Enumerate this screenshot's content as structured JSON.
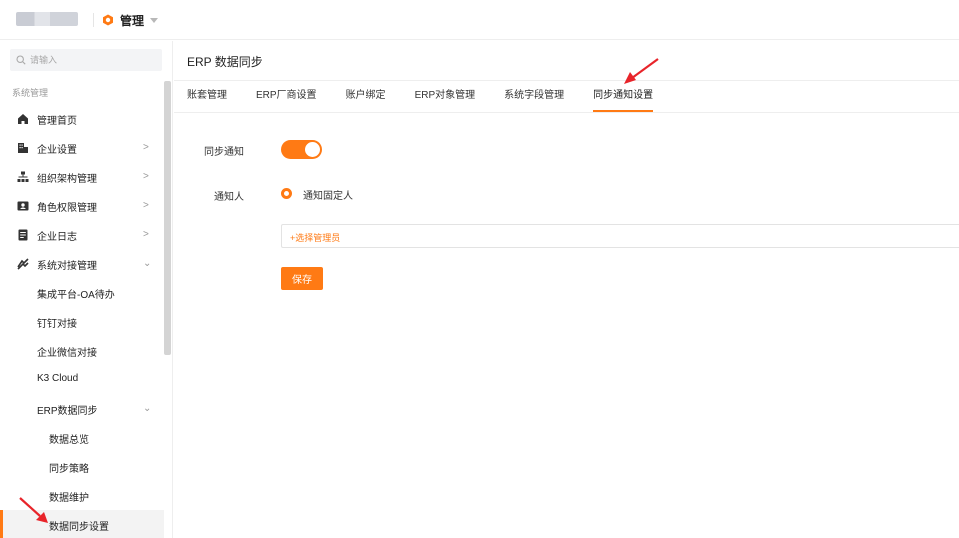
{
  "header": {
    "app_title": "管理",
    "accent": "#ff7a14"
  },
  "sidebar": {
    "search_placeholder": "请输入",
    "section_label": "系统管理",
    "items": [
      {
        "label": "管理首页",
        "icon": "home-icon"
      },
      {
        "label": "企业设置",
        "icon": "building-icon",
        "arrow": ">"
      },
      {
        "label": "组织架构管理",
        "icon": "org-tree-icon",
        "arrow": ">"
      },
      {
        "label": "角色权限管理",
        "icon": "id-card-icon",
        "arrow": ">"
      },
      {
        "label": "企业日志",
        "icon": "document-icon",
        "arrow": ">"
      },
      {
        "label": "系统对接管理",
        "icon": "link-icon",
        "arrow": "⌄"
      }
    ],
    "sub_items": [
      "集成平台-OA待办",
      "钉钉对接",
      "企业微信对接",
      "K3 Cloud"
    ],
    "erp_group": {
      "label": "ERP数据同步",
      "arrow": "⌄"
    },
    "erp_items": [
      "数据总览",
      "同步策略",
      "数据维护",
      "数据同步设置"
    ]
  },
  "main": {
    "title": "ERP 数据同步",
    "tabs": [
      "账套管理",
      "ERP厂商设置",
      "账户绑定",
      "ERP对象管理",
      "系统字段管理",
      "同步通知设置"
    ],
    "active_tab": "同步通知设置",
    "form": {
      "notify_label": "同步通知",
      "notify_enabled": true,
      "recipient_label": "通知人",
      "recipient_option": "通知固定人",
      "select_admin": "+选择管理员",
      "save_label": "保存"
    }
  }
}
